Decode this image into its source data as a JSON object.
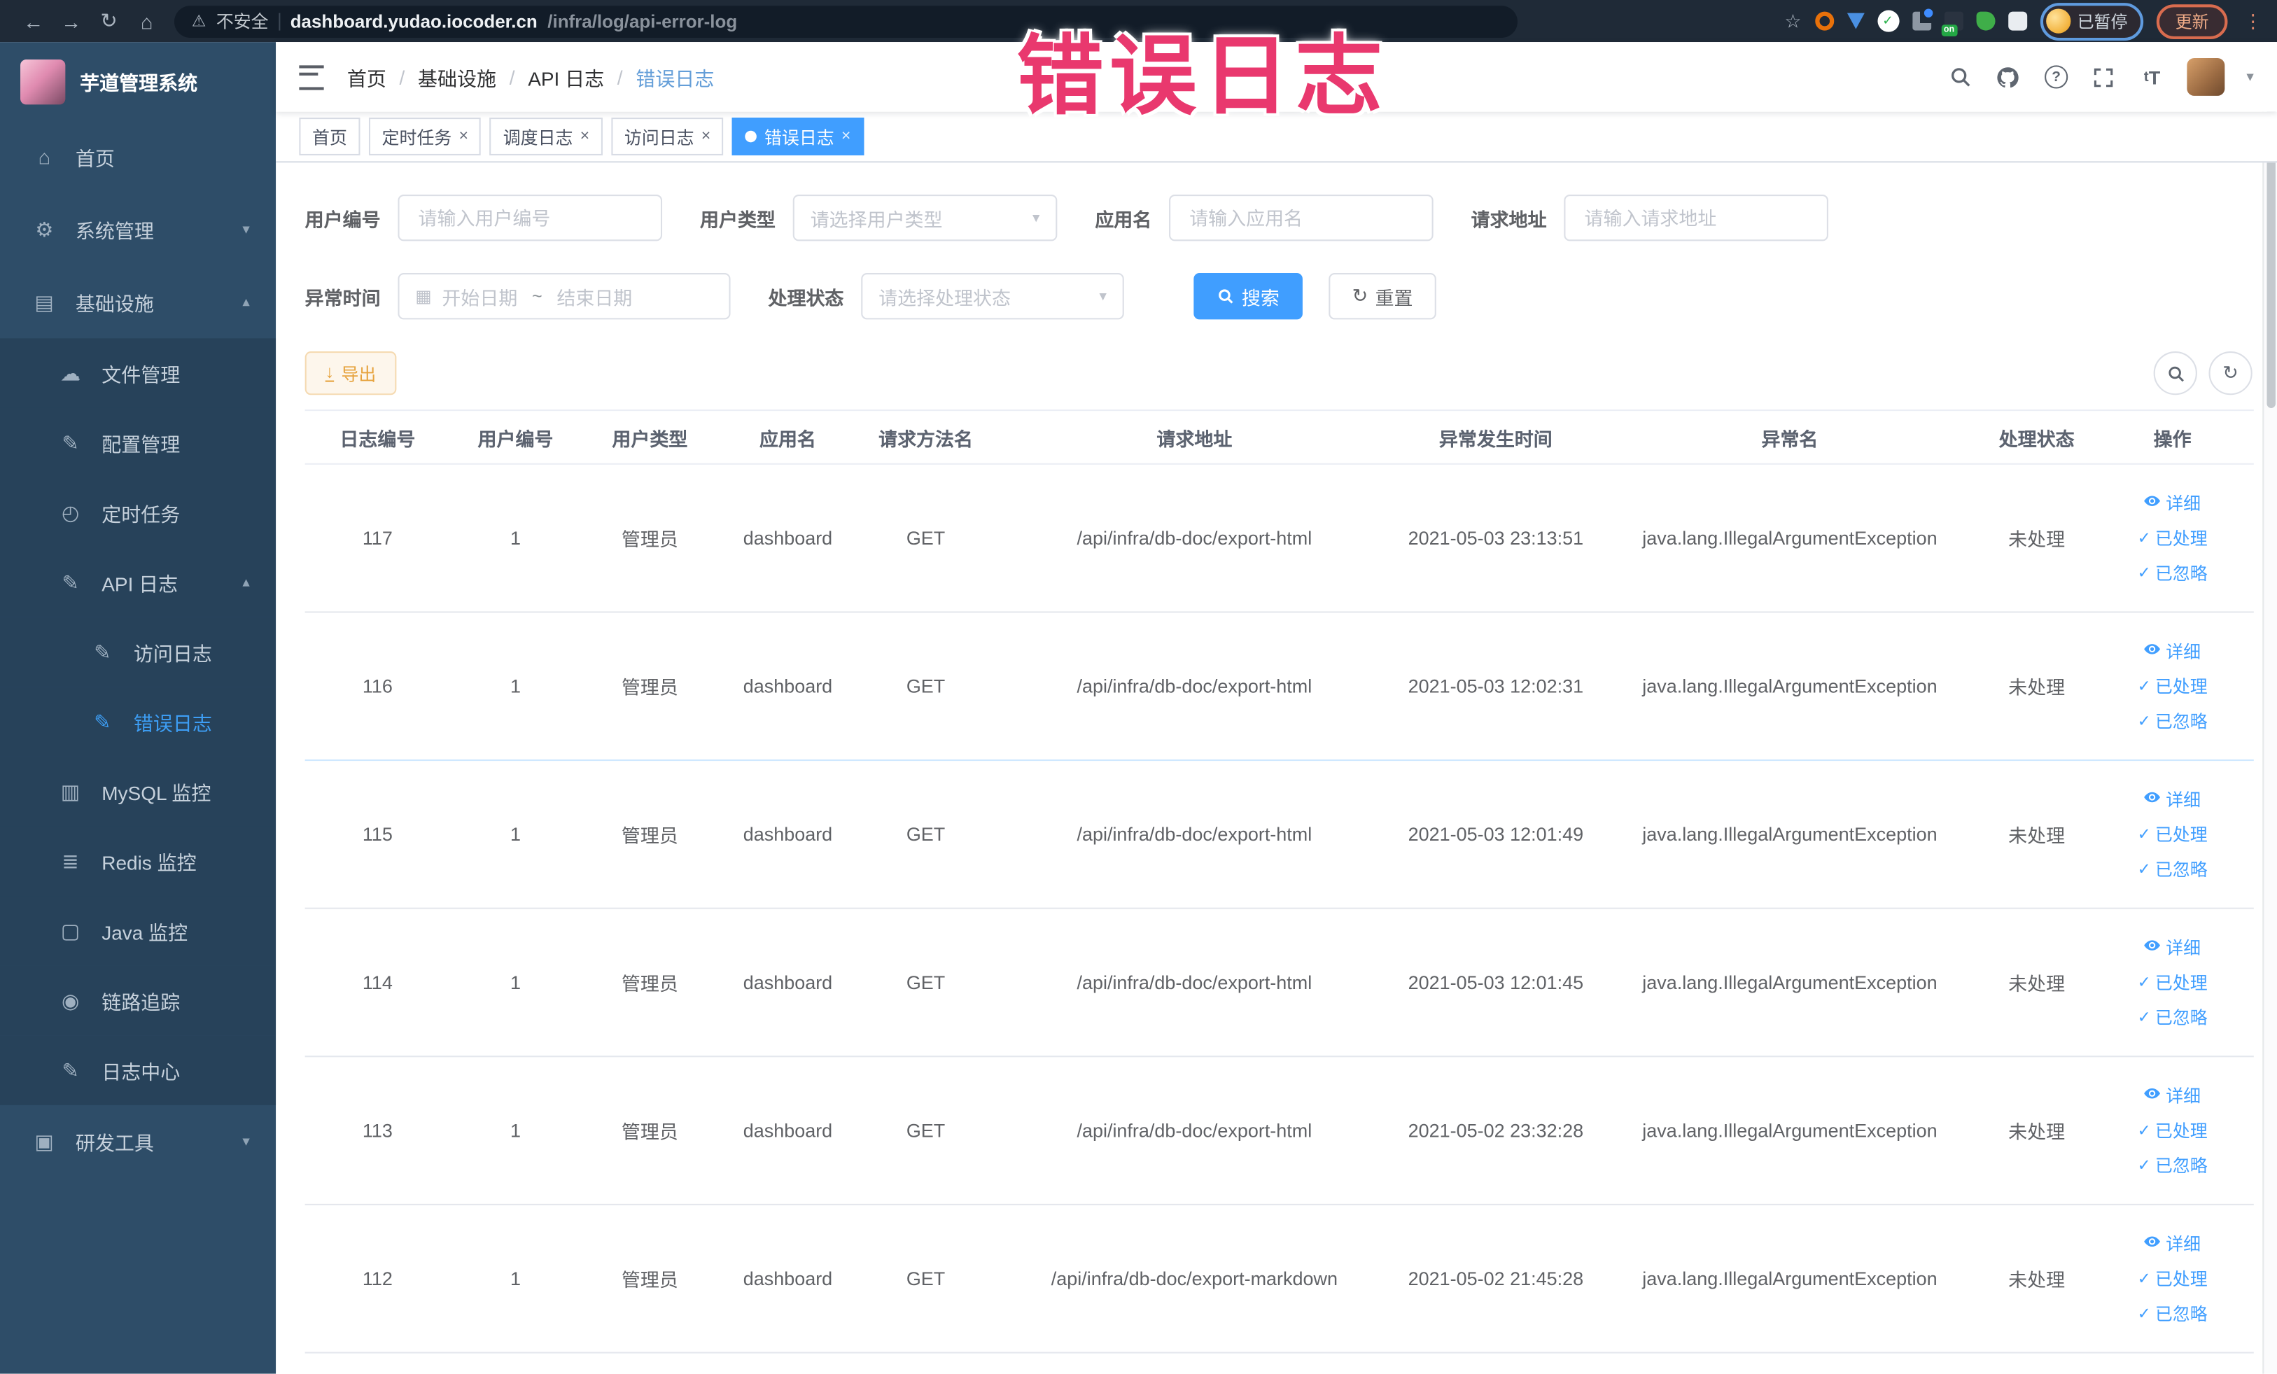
{
  "overlay": {
    "title": "错误日志"
  },
  "browser": {
    "icons": {
      "back": "←",
      "forward": "→",
      "reload": "↻",
      "home": "⌂",
      "warning": "⚠",
      "star": "☆",
      "menu_dots": "⋮"
    },
    "security_label": "不安全",
    "url_host": "dashboard.yudao.iocoder.cn",
    "url_path": "/infra/log/api-error-log",
    "ext_badge_label": "on",
    "profile_paused_label": "已暂停",
    "update_label": "更新"
  },
  "sidebar": {
    "app_title": "芋道管理系统",
    "items": [
      {
        "name": "home",
        "label": "首页",
        "glyph": "⌂",
        "icon": "home-icon",
        "level": 1
      },
      {
        "name": "system",
        "label": "系统管理",
        "glyph": "⚙",
        "icon": "gear-icon",
        "level": 1,
        "chevron": "down"
      },
      {
        "name": "infra",
        "label": "基础设施",
        "glyph": "▤",
        "icon": "monitor-icon",
        "level": 1,
        "chevron": "up"
      },
      {
        "name": "file",
        "label": "文件管理",
        "glyph": "☁",
        "icon": "cloud-upload-icon",
        "level": 2,
        "sub": true
      },
      {
        "name": "config",
        "label": "配置管理",
        "glyph": "✎",
        "icon": "edit-icon",
        "level": 2,
        "sub": true
      },
      {
        "name": "job",
        "label": "定时任务",
        "glyph": "◴",
        "icon": "clock-icon",
        "level": 2,
        "sub": true
      },
      {
        "name": "api-log",
        "label": "API 日志",
        "glyph": "✎",
        "icon": "log-icon",
        "level": 2,
        "sub": true,
        "chevron": "up"
      },
      {
        "name": "access-log",
        "label": "访问日志",
        "glyph": "✎",
        "icon": "log-icon",
        "level": 3,
        "sub": true
      },
      {
        "name": "error-log",
        "label": "错误日志",
        "glyph": "✎",
        "icon": "log-icon",
        "level": 3,
        "sub": true,
        "active": true
      },
      {
        "name": "mysql",
        "label": "MySQL 监控",
        "glyph": "▥",
        "icon": "mysql-monitor-icon",
        "level": 2,
        "sub": true
      },
      {
        "name": "redis",
        "label": "Redis 监控",
        "glyph": "≣",
        "icon": "redis-monitor-icon",
        "level": 2,
        "sub": true
      },
      {
        "name": "java",
        "label": "Java 监控",
        "glyph": "▢",
        "icon": "java-monitor-icon",
        "level": 2,
        "sub": true
      },
      {
        "name": "trace",
        "label": "链路追踪",
        "glyph": "◉",
        "icon": "trace-icon",
        "level": 2,
        "sub": true
      },
      {
        "name": "log-center",
        "label": "日志中心",
        "glyph": "✎",
        "icon": "log-center-icon",
        "level": 2,
        "sub": true
      },
      {
        "name": "dev-tools",
        "label": "研发工具",
        "glyph": "▣",
        "icon": "briefcase-icon",
        "level": 1,
        "chevron": "down"
      }
    ]
  },
  "breadcrumb": [
    "首页",
    "基础设施",
    "API 日志",
    "错误日志"
  ],
  "tabs": [
    {
      "label": "首页",
      "closable": false,
      "active": false
    },
    {
      "label": "定时任务",
      "closable": true,
      "active": false
    },
    {
      "label": "调度日志",
      "closable": true,
      "active": false
    },
    {
      "label": "访问日志",
      "closable": true,
      "active": false
    },
    {
      "label": "错误日志",
      "closable": true,
      "active": true
    }
  ],
  "filters": {
    "user_id": {
      "label": "用户编号",
      "placeholder": "请输入用户编号"
    },
    "user_type": {
      "label": "用户类型",
      "placeholder": "请选择用户类型"
    },
    "app_name": {
      "label": "应用名",
      "placeholder": "请输入应用名"
    },
    "request_url": {
      "label": "请求地址",
      "placeholder": "请输入请求地址"
    },
    "exception_time": {
      "label": "异常时间",
      "start_placeholder": "开始日期",
      "separator": "~",
      "end_placeholder": "结束日期"
    },
    "process_status": {
      "label": "处理状态",
      "placeholder": "请选择处理状态"
    },
    "search_label": "搜索",
    "reset_label": "重置"
  },
  "toolbar": {
    "export_label": "导出"
  },
  "table": {
    "headers": [
      "日志编号",
      "用户编号",
      "用户类型",
      "应用名",
      "请求方法名",
      "请求地址",
      "异常发生时间",
      "异常名",
      "处理状态",
      "操作"
    ],
    "actions": [
      "详细",
      "已处理",
      "已忽略"
    ],
    "rows": [
      {
        "log_id": "117",
        "user_id": "1",
        "user_type": "管理员",
        "app_name": "dashboard",
        "method": "GET",
        "url": "/api/infra/db-doc/export-html",
        "time": "2021-05-03 23:13:51",
        "exception": "java.lang.IllegalArgumentException",
        "status": "未处理"
      },
      {
        "log_id": "116",
        "user_id": "1",
        "user_type": "管理员",
        "app_name": "dashboard",
        "method": "GET",
        "url": "/api/infra/db-doc/export-html",
        "time": "2021-05-03 12:02:31",
        "exception": "java.lang.IllegalArgumentException",
        "status": "未处理"
      },
      {
        "log_id": "115",
        "user_id": "1",
        "user_type": "管理员",
        "app_name": "dashboard",
        "method": "GET",
        "url": "/api/infra/db-doc/export-html",
        "time": "2021-05-03 12:01:49",
        "exception": "java.lang.IllegalArgumentException",
        "status": "未处理"
      },
      {
        "log_id": "114",
        "user_id": "1",
        "user_type": "管理员",
        "app_name": "dashboard",
        "method": "GET",
        "url": "/api/infra/db-doc/export-html",
        "time": "2021-05-03 12:01:45",
        "exception": "java.lang.IllegalArgumentException",
        "status": "未处理"
      },
      {
        "log_id": "113",
        "user_id": "1",
        "user_type": "管理员",
        "app_name": "dashboard",
        "method": "GET",
        "url": "/api/infra/db-doc/export-html",
        "time": "2021-05-02 23:32:28",
        "exception": "java.lang.IllegalArgumentException",
        "status": "未处理"
      },
      {
        "log_id": "112",
        "user_id": "1",
        "user_type": "管理员",
        "app_name": "dashboard",
        "method": "GET",
        "url": "/api/infra/db-doc/export-markdown",
        "time": "2021-05-02 21:45:28",
        "exception": "java.lang.IllegalArgumentException",
        "status": "未处理"
      }
    ]
  },
  "colors": {
    "primary": "#409eff",
    "active_menu": "#3d9ef5",
    "sidebar_bg": "#2e4d68",
    "sidebar_sub_bg": "#27425a",
    "export_warning": "#e6a23c",
    "overlay_pink": "#e9386e"
  }
}
